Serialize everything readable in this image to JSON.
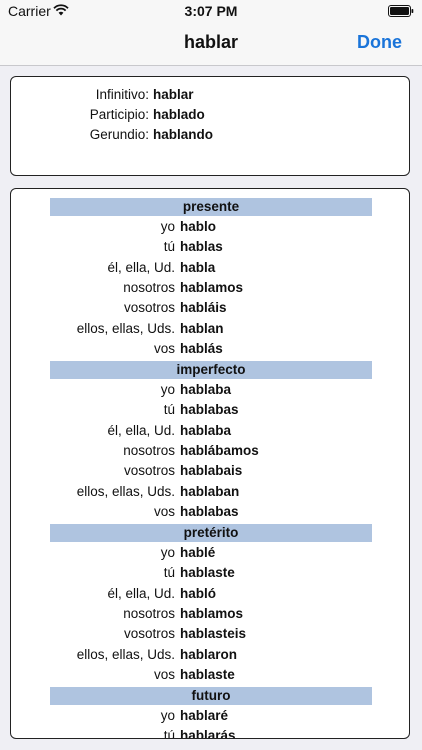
{
  "status_bar": {
    "carrier": "Carrier",
    "time": "3:07 PM",
    "wifi_icon": "wifi-icon",
    "battery_icon": "battery-icon"
  },
  "nav": {
    "title": "hablar",
    "done_label": "Done",
    "accent_color": "#1a74d9"
  },
  "forms": [
    {
      "label": "Infinitivo:",
      "value": "hablar"
    },
    {
      "label": "Participio:",
      "value": "hablado"
    },
    {
      "label": "Gerundio:",
      "value": "hablando"
    }
  ],
  "tense_header_color": "#afc4e0",
  "tenses": [
    {
      "name": "presente",
      "rows": [
        {
          "pronoun": "yo",
          "form": "hablo"
        },
        {
          "pronoun": "tú",
          "form": "hablas"
        },
        {
          "pronoun": "él, ella, Ud.",
          "form": "habla"
        },
        {
          "pronoun": "nosotros",
          "form": "hablamos"
        },
        {
          "pronoun": "vosotros",
          "form": "habláis"
        },
        {
          "pronoun": "ellos, ellas, Uds.",
          "form": "hablan"
        },
        {
          "pronoun": "vos",
          "form": "hablás"
        }
      ]
    },
    {
      "name": "imperfecto",
      "rows": [
        {
          "pronoun": "yo",
          "form": "hablaba"
        },
        {
          "pronoun": "tú",
          "form": "hablabas"
        },
        {
          "pronoun": "él, ella, Ud.",
          "form": "hablaba"
        },
        {
          "pronoun": "nosotros",
          "form": "hablábamos"
        },
        {
          "pronoun": "vosotros",
          "form": "hablabais"
        },
        {
          "pronoun": "ellos, ellas, Uds.",
          "form": "hablaban"
        },
        {
          "pronoun": "vos",
          "form": "hablabas"
        }
      ]
    },
    {
      "name": "pretérito",
      "rows": [
        {
          "pronoun": "yo",
          "form": "hablé"
        },
        {
          "pronoun": "tú",
          "form": "hablaste"
        },
        {
          "pronoun": "él, ella, Ud.",
          "form": "habló"
        },
        {
          "pronoun": "nosotros",
          "form": "hablamos"
        },
        {
          "pronoun": "vosotros",
          "form": "hablasteis"
        },
        {
          "pronoun": "ellos, ellas, Uds.",
          "form": "hablaron"
        },
        {
          "pronoun": "vos",
          "form": "hablaste"
        }
      ]
    },
    {
      "name": "futuro",
      "rows": [
        {
          "pronoun": "yo",
          "form": "hablaré"
        },
        {
          "pronoun": "tú",
          "form": "hablarás"
        }
      ]
    }
  ]
}
